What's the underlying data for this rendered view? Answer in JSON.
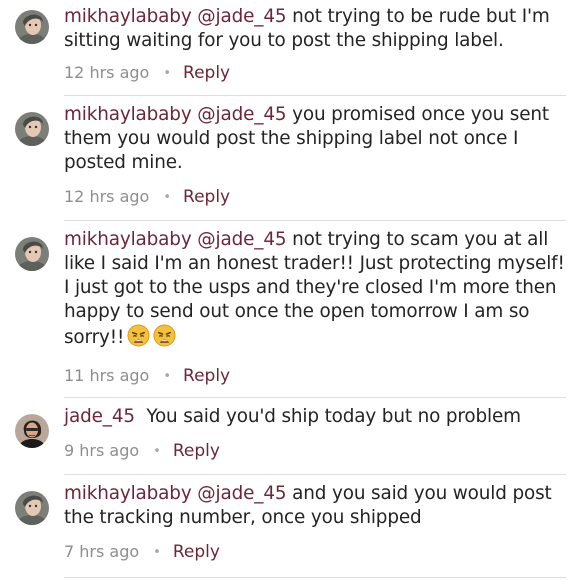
{
  "comments": [
    {
      "author": "mikhaylababy",
      "mention": "@jade_45",
      "text": " not trying to be rude but I'm sitting waiting for you to post the shipping label.",
      "time": "12 hrs ago",
      "reply_label": "Reply",
      "avatar": "avatar-girl-grey-shirt",
      "emoji": []
    },
    {
      "author": "mikhaylababy",
      "mention": "@jade_45",
      "text": " you promised once you sent them you would post the shipping label not once I posted mine.",
      "time": "12 hrs ago",
      "reply_label": "Reply",
      "avatar": "avatar-girl-grey-shirt",
      "emoji": []
    },
    {
      "author": "mikhaylababy",
      "mention": "@jade_45",
      "text": " not trying to scam you at all like I said I'm an honest trader!! Just protecting myself! I just got to the usps and they're closed I'm more then happy to send out once the open tomorrow I am so sorry!!",
      "time": "11 hrs ago",
      "reply_label": "Reply",
      "avatar": "avatar-girl-grey-shirt",
      "emoji": [
        "weary-face-icon",
        "weary-face-icon"
      ]
    },
    {
      "author": "jade_45",
      "mention": "",
      "text": "  You said you'd ship today but no problem",
      "time": "9 hrs ago",
      "reply_label": "Reply",
      "avatar": "avatar-dark-hair",
      "emoji": []
    },
    {
      "author": "mikhaylababy",
      "mention": "@jade_45",
      "text": " and you said you would post the tracking number, once you shipped",
      "time": "7 hrs ago",
      "reply_label": "Reply",
      "avatar": "avatar-girl-grey-shirt",
      "emoji": []
    }
  ],
  "colors": {
    "link": "#6b2739",
    "text": "#242424",
    "meta": "#8e8e8e",
    "divider": "#dedede"
  }
}
